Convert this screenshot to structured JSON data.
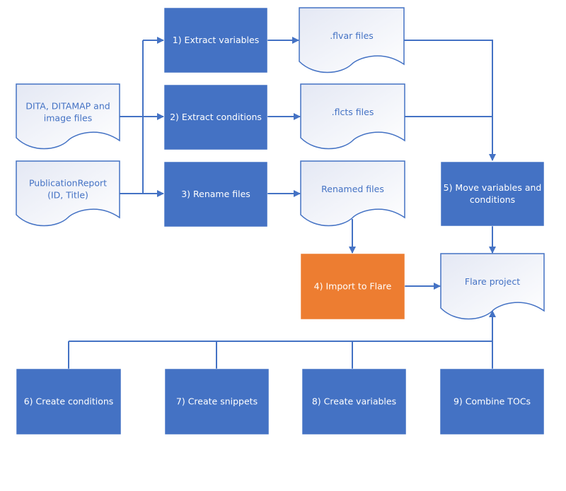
{
  "colors": {
    "process": "#4472c4",
    "process_highlight": "#ed7d31",
    "doc_stroke": "#4472c4",
    "doc_fill_start": "#e4e8f4",
    "doc_fill_end": "#ffffff",
    "connector": "#4472c4"
  },
  "nodes": {
    "input_dita": {
      "type": "document",
      "lines": [
        "DITA, DITAMAP and",
        "image files"
      ]
    },
    "input_report": {
      "type": "document",
      "lines": [
        "PublicationReport",
        "(ID, Title)"
      ]
    },
    "step1": {
      "type": "process",
      "lines": [
        "1) Extract variables"
      ]
    },
    "step2": {
      "type": "process",
      "lines": [
        "2) Extract conditions"
      ]
    },
    "step3": {
      "type": "process",
      "lines": [
        "3) Rename files"
      ]
    },
    "flvar": {
      "type": "document",
      "lines": [
        ".flvar files"
      ]
    },
    "flcts": {
      "type": "document",
      "lines": [
        ".flcts files"
      ]
    },
    "renamed": {
      "type": "document",
      "lines": [
        "Renamed files"
      ]
    },
    "step5": {
      "type": "process",
      "lines": [
        "5) Move variables and",
        "conditions"
      ]
    },
    "step4": {
      "type": "process-highlight",
      "lines": [
        "4) Import to Flare"
      ]
    },
    "flare_project": {
      "type": "document",
      "lines": [
        "Flare project"
      ]
    },
    "step6": {
      "type": "process",
      "lines": [
        "6) Create conditions"
      ]
    },
    "step7": {
      "type": "process",
      "lines": [
        "7) Create snippets"
      ]
    },
    "step8": {
      "type": "process",
      "lines": [
        "8) Create variables"
      ]
    },
    "step9": {
      "type": "process",
      "lines": [
        "9) Combine TOCs"
      ]
    }
  },
  "edges": [
    {
      "from": "input_dita",
      "to": "step1"
    },
    {
      "from": "input_dita",
      "to": "step2"
    },
    {
      "from": "input_dita",
      "to": "step3"
    },
    {
      "from": "input_report",
      "to": "step1"
    },
    {
      "from": "input_report",
      "to": "step2"
    },
    {
      "from": "input_report",
      "to": "step3"
    },
    {
      "from": "step1",
      "to": "flvar"
    },
    {
      "from": "step2",
      "to": "flcts"
    },
    {
      "from": "step3",
      "to": "renamed"
    },
    {
      "from": "flvar",
      "to": "step5"
    },
    {
      "from": "flcts",
      "to": "step5"
    },
    {
      "from": "renamed",
      "to": "step4"
    },
    {
      "from": "step4",
      "to": "flare_project"
    },
    {
      "from": "step5",
      "to": "flare_project"
    },
    {
      "from": "step6",
      "to": "flare_project"
    },
    {
      "from": "step7",
      "to": "flare_project"
    },
    {
      "from": "step8",
      "to": "flare_project"
    },
    {
      "from": "step9",
      "to": "flare_project"
    }
  ]
}
